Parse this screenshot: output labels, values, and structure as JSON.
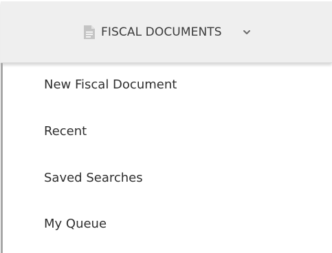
{
  "menu": {
    "title": "FISCAL DOCUMENTS",
    "title_icon": "document-icon",
    "toggle_icon": "chevron-down-icon",
    "items": [
      {
        "label": "New Fiscal Document"
      },
      {
        "label": "Recent"
      },
      {
        "label": "Saved Searches"
      },
      {
        "label": "My Queue"
      }
    ]
  },
  "colors": {
    "header_bg": "#efefef",
    "text": "#2e2e2e",
    "icon": "#c4c4c4",
    "rule": "#a6a6a6"
  }
}
